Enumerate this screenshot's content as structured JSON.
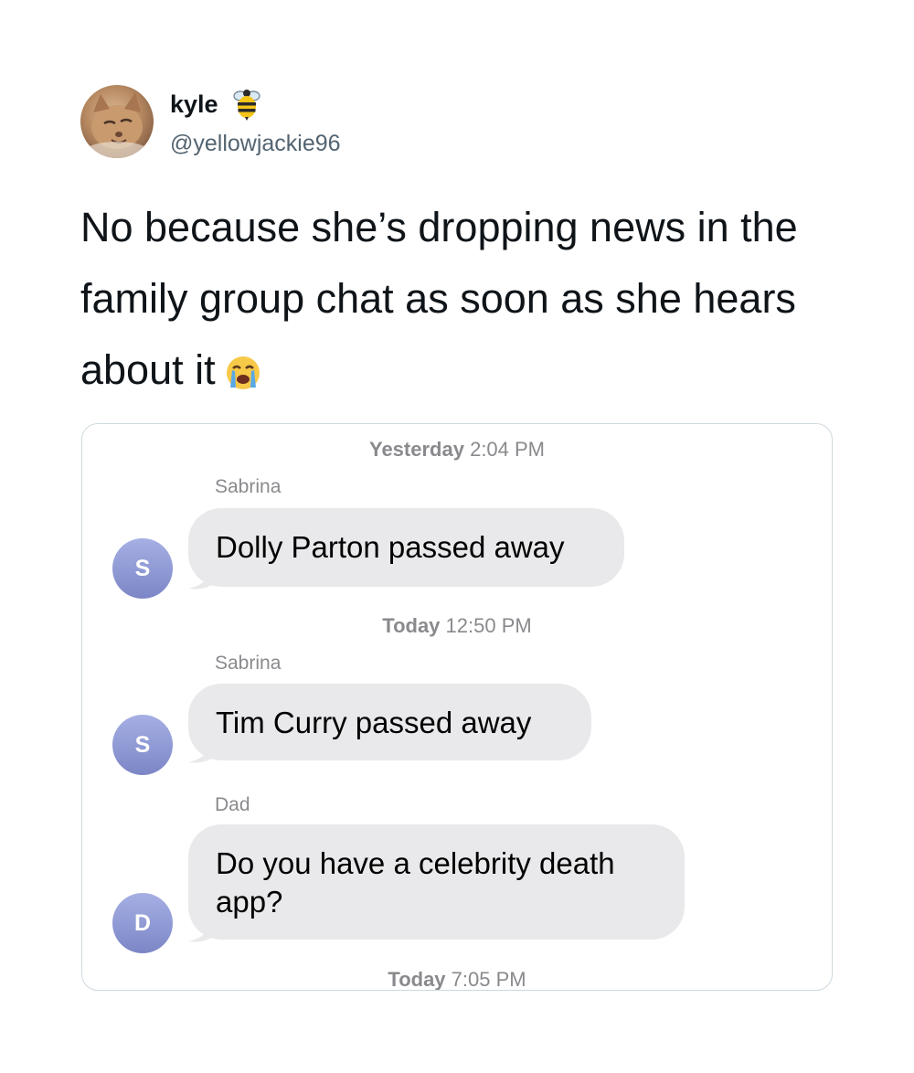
{
  "tweet": {
    "display_name": "kyle",
    "handle": "@yellowjackie96",
    "name_emoji": "bee-icon",
    "text": "No because she’s dropping news in the family group chat as soon as she hears about it",
    "text_emoji": "loudly-crying-face-icon"
  },
  "chat": {
    "timestamps": [
      {
        "day": "Yesterday",
        "time": "2:04 PM"
      },
      {
        "day": "Today",
        "time": "12:50 PM"
      },
      {
        "day": "Today",
        "time": "7:05 PM"
      }
    ],
    "messages": [
      {
        "sender": "Sabrina",
        "initial": "S",
        "text": "Dolly Parton passed away"
      },
      {
        "sender": "Sabrina",
        "initial": "S",
        "text": "Tim Curry passed away"
      },
      {
        "sender": "Dad",
        "initial": "D",
        "text": "Do you have a celebrity death app?"
      }
    ]
  },
  "colors": {
    "bubble": "#e9e9eb",
    "avatar_gradient_top": "#a6b0e4",
    "avatar_gradient_bottom": "#7c86c6",
    "handle": "#536471",
    "timestamp": "#8a8a8e"
  }
}
